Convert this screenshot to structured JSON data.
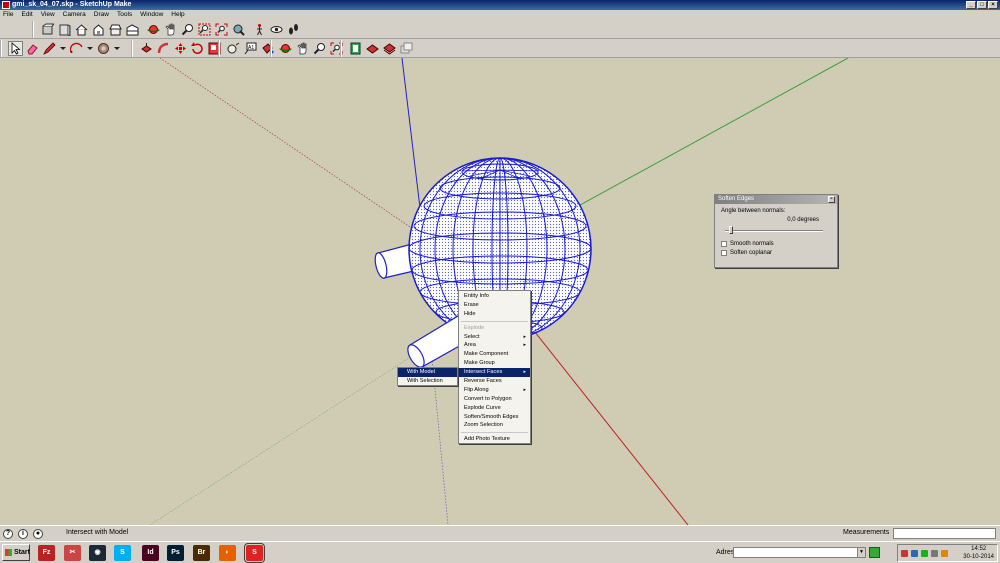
{
  "window": {
    "title": "gmi_sk_04_07.skp - SketchUp Make",
    "controls": [
      "_",
      "□",
      "×"
    ]
  },
  "menu": [
    "File",
    "Edit",
    "View",
    "Camera",
    "Draw",
    "Tools",
    "Window",
    "Help"
  ],
  "toolbar_top": {
    "icons": [
      "components-icon",
      "materials-icon",
      "home-icon",
      "house-front-icon",
      "house-open-icon",
      "house-side-icon",
      "orbit-icon",
      "pan-icon",
      "zoom-icon",
      "zoom-window-icon",
      "zoom-extents-icon",
      "position-camera-icon",
      "walk-icon",
      "look-around-icon",
      "footprints-icon"
    ]
  },
  "toolbar_main": {
    "icons": [
      "select-arrow-icon",
      "eraser-icon",
      "pencil-icon",
      "arc-icon",
      "tape-measure-icon",
      "push-pull-icon",
      "follow-me-icon",
      "move-icon",
      "rotate-icon",
      "scale-icon",
      "dimension-icon",
      "text-icon",
      "paint-bucket-icon",
      "orbit-icon",
      "pan-icon",
      "zoom-icon",
      "zoom-extents-icon",
      "previous-view-icon",
      "next-view-icon",
      "warehouse-icon",
      "extension-icon",
      "share-icon"
    ]
  },
  "dialog": {
    "title": "Soften Edges",
    "angle_label": "Angle between normals:",
    "angle_value": "0,0  degrees",
    "angle_degrees": 0,
    "smooth_label": "Smooth normals",
    "coplanar_label": "Soften coplanar",
    "close": "×"
  },
  "context_menu": {
    "items": [
      {
        "label": "Entity Info",
        "state": "normal"
      },
      {
        "label": "Erase",
        "state": "normal"
      },
      {
        "label": "Hide",
        "state": "normal"
      },
      {
        "label": "Explode",
        "state": "disabled"
      },
      {
        "label": "Select",
        "state": "normal",
        "submenu": true
      },
      {
        "label": "Area",
        "state": "normal",
        "submenu": true
      },
      {
        "label": "Make Component",
        "state": "normal"
      },
      {
        "label": "Make Group",
        "state": "normal"
      },
      {
        "label": "Intersect Faces",
        "state": "highlighted",
        "submenu": true
      },
      {
        "label": "Reverse Faces",
        "state": "normal"
      },
      {
        "label": "Flip Along",
        "state": "normal",
        "submenu": true
      },
      {
        "label": "Convert to Polygon",
        "state": "normal"
      },
      {
        "label": "Explode Curve",
        "state": "normal"
      },
      {
        "label": "Soften/Smooth Edges",
        "state": "normal"
      },
      {
        "label": "Zoom Selection",
        "state": "normal"
      },
      {
        "label": "Add Photo Texture",
        "state": "normal"
      }
    ],
    "submenu_arrow": "▸",
    "submenu": [
      {
        "label": "With Model",
        "state": "highlighted"
      },
      {
        "label": "With Selection",
        "state": "normal"
      }
    ]
  },
  "statusbar": {
    "icons": [
      "help-icon",
      "info-icon",
      "user-icon"
    ],
    "icon_glyphs": [
      "?",
      "i",
      "●"
    ],
    "text": "Intersect with Model",
    "measurements_label": "Measurements",
    "measurements_value": ""
  },
  "taskbar": {
    "start_label": "Start",
    "apps": [
      {
        "name": "filezilla-icon",
        "label": "Fz",
        "color": "#b22"
      },
      {
        "name": "snipping-tool-icon",
        "label": "✂",
        "color": "#c44"
      },
      {
        "name": "steam-icon",
        "label": "◉",
        "color": "#1b2838"
      },
      {
        "name": "skype-icon",
        "label": "S",
        "color": "#00aff0"
      },
      {
        "name": "indesign-icon",
        "label": "Id",
        "color": "#49021f"
      },
      {
        "name": "photoshop-icon",
        "label": "Ps",
        "color": "#001e36"
      },
      {
        "name": "bridge-icon",
        "label": "Br",
        "color": "#4a2a00"
      },
      {
        "name": "firefox-icon",
        "label": "◐",
        "color": "#e66000"
      },
      {
        "name": "sketchup-icon",
        "label": "S",
        "color": "#d22"
      }
    ],
    "address_label": "Adres",
    "address_value": "",
    "time": "14:52",
    "date": "30-10-2014"
  }
}
